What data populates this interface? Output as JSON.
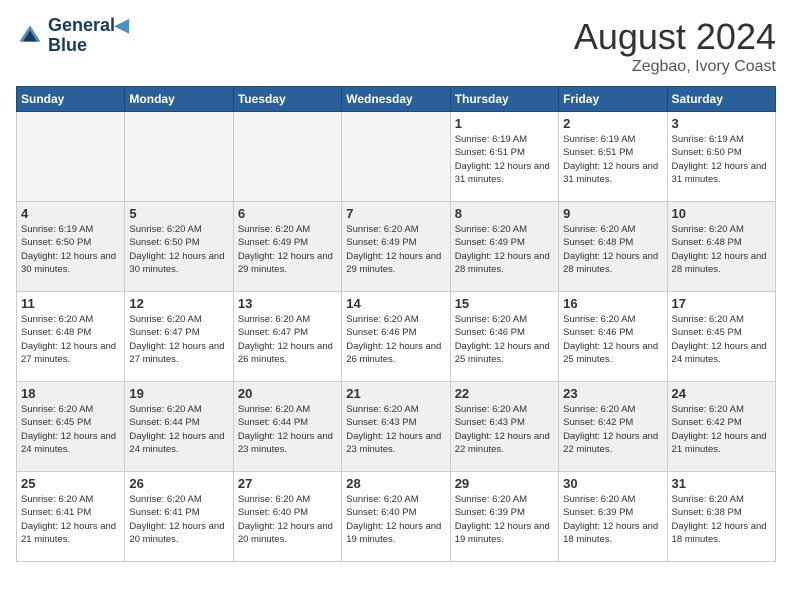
{
  "header": {
    "logo": {
      "line1": "General",
      "line2": "Blue"
    },
    "title": "August 2024",
    "subtitle": "Zegbao, Ivory Coast"
  },
  "weekdays": [
    "Sunday",
    "Monday",
    "Tuesday",
    "Wednesday",
    "Thursday",
    "Friday",
    "Saturday"
  ],
  "weeks": [
    [
      {
        "day": null,
        "empty": true
      },
      {
        "day": null,
        "empty": true
      },
      {
        "day": null,
        "empty": true
      },
      {
        "day": null,
        "empty": true
      },
      {
        "day": 1,
        "sunrise": "6:19 AM",
        "sunset": "6:51 PM",
        "daylight": "12 hours and 31 minutes"
      },
      {
        "day": 2,
        "sunrise": "6:19 AM",
        "sunset": "6:51 PM",
        "daylight": "12 hours and 31 minutes"
      },
      {
        "day": 3,
        "sunrise": "6:19 AM",
        "sunset": "6:50 PM",
        "daylight": "12 hours and 31 minutes"
      }
    ],
    [
      {
        "day": 4,
        "sunrise": "6:19 AM",
        "sunset": "6:50 PM",
        "daylight": "12 hours and 30 minutes"
      },
      {
        "day": 5,
        "sunrise": "6:20 AM",
        "sunset": "6:50 PM",
        "daylight": "12 hours and 30 minutes"
      },
      {
        "day": 6,
        "sunrise": "6:20 AM",
        "sunset": "6:49 PM",
        "daylight": "12 hours and 29 minutes"
      },
      {
        "day": 7,
        "sunrise": "6:20 AM",
        "sunset": "6:49 PM",
        "daylight": "12 hours and 29 minutes"
      },
      {
        "day": 8,
        "sunrise": "6:20 AM",
        "sunset": "6:49 PM",
        "daylight": "12 hours and 28 minutes"
      },
      {
        "day": 9,
        "sunrise": "6:20 AM",
        "sunset": "6:48 PM",
        "daylight": "12 hours and 28 minutes"
      },
      {
        "day": 10,
        "sunrise": "6:20 AM",
        "sunset": "6:48 PM",
        "daylight": "12 hours and 28 minutes"
      }
    ],
    [
      {
        "day": 11,
        "sunrise": "6:20 AM",
        "sunset": "6:48 PM",
        "daylight": "12 hours and 27 minutes"
      },
      {
        "day": 12,
        "sunrise": "6:20 AM",
        "sunset": "6:47 PM",
        "daylight": "12 hours and 27 minutes"
      },
      {
        "day": 13,
        "sunrise": "6:20 AM",
        "sunset": "6:47 PM",
        "daylight": "12 hours and 26 minutes"
      },
      {
        "day": 14,
        "sunrise": "6:20 AM",
        "sunset": "6:46 PM",
        "daylight": "12 hours and 26 minutes"
      },
      {
        "day": 15,
        "sunrise": "6:20 AM",
        "sunset": "6:46 PM",
        "daylight": "12 hours and 25 minutes"
      },
      {
        "day": 16,
        "sunrise": "6:20 AM",
        "sunset": "6:46 PM",
        "daylight": "12 hours and 25 minutes"
      },
      {
        "day": 17,
        "sunrise": "6:20 AM",
        "sunset": "6:45 PM",
        "daylight": "12 hours and 24 minutes"
      }
    ],
    [
      {
        "day": 18,
        "sunrise": "6:20 AM",
        "sunset": "6:45 PM",
        "daylight": "12 hours and 24 minutes"
      },
      {
        "day": 19,
        "sunrise": "6:20 AM",
        "sunset": "6:44 PM",
        "daylight": "12 hours and 24 minutes"
      },
      {
        "day": 20,
        "sunrise": "6:20 AM",
        "sunset": "6:44 PM",
        "daylight": "12 hours and 23 minutes"
      },
      {
        "day": 21,
        "sunrise": "6:20 AM",
        "sunset": "6:43 PM",
        "daylight": "12 hours and 23 minutes"
      },
      {
        "day": 22,
        "sunrise": "6:20 AM",
        "sunset": "6:43 PM",
        "daylight": "12 hours and 22 minutes"
      },
      {
        "day": 23,
        "sunrise": "6:20 AM",
        "sunset": "6:42 PM",
        "daylight": "12 hours and 22 minutes"
      },
      {
        "day": 24,
        "sunrise": "6:20 AM",
        "sunset": "6:42 PM",
        "daylight": "12 hours and 21 minutes"
      }
    ],
    [
      {
        "day": 25,
        "sunrise": "6:20 AM",
        "sunset": "6:41 PM",
        "daylight": "12 hours and 21 minutes"
      },
      {
        "day": 26,
        "sunrise": "6:20 AM",
        "sunset": "6:41 PM",
        "daylight": "12 hours and 20 minutes"
      },
      {
        "day": 27,
        "sunrise": "6:20 AM",
        "sunset": "6:40 PM",
        "daylight": "12 hours and 20 minutes"
      },
      {
        "day": 28,
        "sunrise": "6:20 AM",
        "sunset": "6:40 PM",
        "daylight": "12 hours and 19 minutes"
      },
      {
        "day": 29,
        "sunrise": "6:20 AM",
        "sunset": "6:39 PM",
        "daylight": "12 hours and 19 minutes"
      },
      {
        "day": 30,
        "sunrise": "6:20 AM",
        "sunset": "6:39 PM",
        "daylight": "12 hours and 18 minutes"
      },
      {
        "day": 31,
        "sunrise": "6:20 AM",
        "sunset": "6:38 PM",
        "daylight": "12 hours and 18 minutes"
      }
    ]
  ]
}
